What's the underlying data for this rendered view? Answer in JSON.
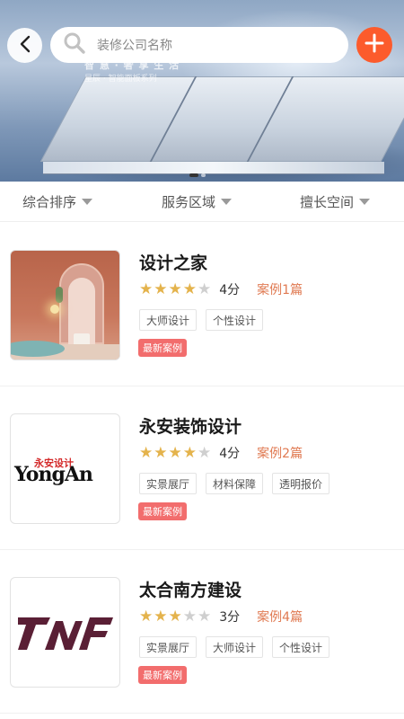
{
  "header": {
    "search_placeholder": "装修公司名称"
  },
  "banner": {
    "headline": "智 慧 · 奢 享 生 活",
    "subline": "星辰 · 智能面板系列",
    "page_index": 0,
    "page_count": 2
  },
  "filters": [
    {
      "label": "综合排序"
    },
    {
      "label": "服务区域"
    },
    {
      "label": "擅长空间"
    }
  ],
  "companies": [
    {
      "name": "设计之家",
      "stars": 4,
      "score": "4分",
      "cases": "案例1篇",
      "tags": [
        "大师设计",
        "个性设计"
      ],
      "badge": "最新案例",
      "thumb": "interior-photo"
    },
    {
      "name": "永安装饰设计",
      "stars": 4,
      "score": "4分",
      "cases": "案例2篇",
      "tags": [
        "实景展厅",
        "材料保障",
        "透明报价"
      ],
      "badge": "最新案例",
      "thumb": "yongan-logo",
      "logo_cn": "永安设计",
      "logo_en": "YongAn"
    },
    {
      "name": "太合南方建设",
      "stars": 3,
      "score": "3分",
      "cases": "案例4篇",
      "tags": [
        "实景展厅",
        "大师设计",
        "个性设计"
      ],
      "badge": "最新案例",
      "thumb": "tnf-logo"
    }
  ],
  "colors": {
    "accent": "#fc5b2c",
    "star_on": "#e4b34c",
    "star_off": "#cfcfcf",
    "cases_text": "#e07a52",
    "badge": "#f26d6d"
  },
  "icons": {
    "back": "chevron-left-icon",
    "search": "search-icon",
    "add": "plus-icon"
  }
}
